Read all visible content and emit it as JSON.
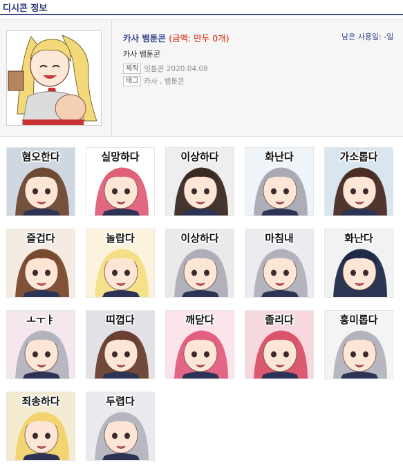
{
  "header": {
    "title": "디시콘 정보"
  },
  "info": {
    "name": "카사 뱀툰콘",
    "price": "(금액: 만두 0개)",
    "remaining": "남은 사용일: -일",
    "subtitle": "카사 뱀툰콘",
    "maker_tag": "제작",
    "maker_value": "잇툰콘",
    "date": "2020.04.08",
    "tags_tag": "태그",
    "tags_value": "카사 , 뱀툰콘"
  },
  "colors": {
    "accent": "#3b4890",
    "price": "#d31900"
  },
  "emoticons": [
    {
      "label": "혐오한다",
      "hair": "#6e4a34",
      "bg": "#cfd8e0"
    },
    {
      "label": "실망하다",
      "hair": "#e0607a",
      "bg": "#ffffff"
    },
    {
      "label": "이상하다",
      "hair": "#3a2a24",
      "bg": "#eeeeee"
    },
    {
      "label": "화난다",
      "hair": "#a9a9b3",
      "bg": "#eef4f8"
    },
    {
      "label": "가소롭다",
      "hair": "#4a2c24",
      "bg": "#d9e6f0"
    },
    {
      "label": "즐겁다",
      "hair": "#7a4a2e",
      "bg": "#f4ece2"
    },
    {
      "label": "놀랍다",
      "hair": "#f5df86",
      "bg": "#fbf3dc"
    },
    {
      "label": "이상하다",
      "hair": "#aeaeb8",
      "bg": "#eaeaea"
    },
    {
      "label": "마침내",
      "hair": "#b1b1bc",
      "bg": "#ecebf0"
    },
    {
      "label": "화난다",
      "hair": "#1f2a4a",
      "bg": "#f2f2f2"
    },
    {
      "label": "ㅗㅜㅑ",
      "hair": "#b3b3be",
      "bg": "#f4e8ee"
    },
    {
      "label": "띠껍다",
      "hair": "#6a4030",
      "bg": "#e2e2e6"
    },
    {
      "label": "깨닫다",
      "hair": "#e25f82",
      "bg": "#fde4ea"
    },
    {
      "label": "졸리다",
      "hair": "#d9536a",
      "bg": "#f6d8de"
    },
    {
      "label": "흥미롭다",
      "hair": "#b3b3be",
      "bg": "#f4f4f4"
    },
    {
      "label": "죄송하다",
      "hair": "#f2d36e",
      "bg": "#f3ecd0"
    },
    {
      "label": "두렵다",
      "hair": "#b5b5c0",
      "bg": "#ebebef"
    }
  ]
}
